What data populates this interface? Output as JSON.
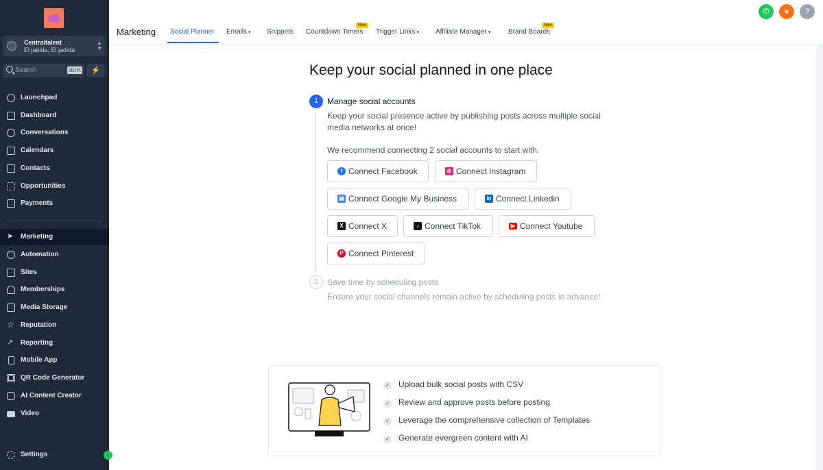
{
  "sidebar": {
    "account_name": "Centraltalent",
    "account_location": "El jadida, El jadida",
    "search_placeholder": "Search",
    "search_shortcut": "ctrl K",
    "nav_top": [
      "Launchpad",
      "Dashboard",
      "Conversations",
      "Calendars",
      "Contacts",
      "Opportunities",
      "Payments"
    ],
    "nav_bottom": [
      "Marketing",
      "Automation",
      "Sites",
      "Memberships",
      "Media Storage",
      "Reputation",
      "Reporting",
      "Mobile App",
      "QR Code Generator",
      "AI Content Creator",
      "Video"
    ],
    "active_item": "Marketing",
    "settings_label": "Settings"
  },
  "topbar": {
    "title": "Marketing",
    "tabs": [
      "Social Planner",
      "Emails",
      "Snippets",
      "Countdown Timers",
      "Trigger Links",
      "Affiliate Manager",
      "Brand Boards"
    ],
    "active_tab": "Social Planner",
    "new_badge": "New",
    "help_label": "?"
  },
  "main": {
    "heading": "Keep your social planned in one place",
    "step1": {
      "number": "1",
      "title": "Manage social accounts",
      "description": "Keep your social presence active by publishing posts across multiple social media networks at once!",
      "recommend": "We recommend connecting 2 social accounts to start with."
    },
    "buttons": {
      "facebook": "Connect Facebook",
      "instagram": "Connect Instagram",
      "google": "Connect Google My Business",
      "linkedin": "Connect Linkedin",
      "x": "Connect X",
      "tiktok": "Connect TikTok",
      "youtube": "Connect Youtube",
      "pinterest": "Connect Pinterest"
    },
    "step2": {
      "number": "2",
      "title": "Save time by scheduling posts",
      "description": "Ensure your social channels remain active by scheduling posts in advance!"
    }
  },
  "features": [
    "Upload bulk social posts with CSV",
    "Review and approve posts before posting",
    "Leverage the comprehensive collection of Templates",
    "Generate evergreen content with AI"
  ],
  "colors": {
    "sidebar_bg": "#1e2a3b",
    "accent": "#2563eb",
    "phone_btn": "#22c55e",
    "bell_btn": "#f97316",
    "help_btn": "#9ca3af"
  }
}
